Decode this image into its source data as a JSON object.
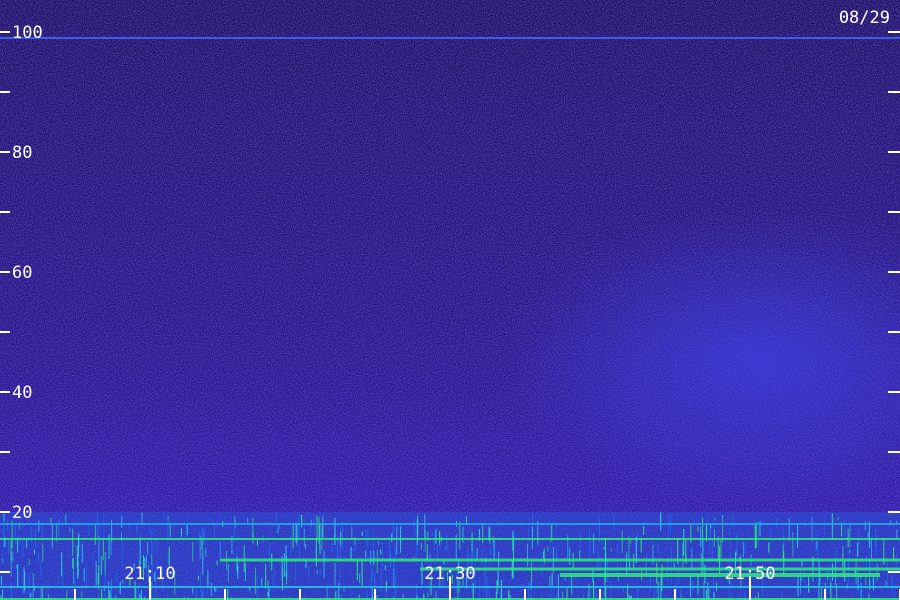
{
  "chart_data": {
    "type": "heatmap",
    "title": "",
    "date": "08/29",
    "xlabel": "",
    "ylabel": "",
    "y_range": [
      0,
      100
    ],
    "y_tick_labels": [
      "100",
      "80",
      "60",
      "40",
      "20"
    ],
    "y_minor_ticks": [
      90,
      70,
      50,
      30,
      10
    ],
    "x_tick_labels": [
      "21:10",
      "21:30",
      "21:50"
    ],
    "x_range_minutes": [
      21,
      81
    ],
    "x_major_ticks_min": [
      26,
      46,
      66
    ],
    "x_minor_ticks_min": [
      31,
      36,
      41,
      51,
      56,
      61,
      71,
      76
    ],
    "colors": {
      "background": "#1a0b4a",
      "noise_high": "#3b22b8",
      "enhanced": "#3343e6",
      "low_band": "#1f6cf0",
      "line_green": "#2cf07a",
      "text": "#ffffff"
    },
    "features": [
      {
        "description_free": true,
        "y_from": 0,
        "y_to": 20,
        "level": "strong",
        "x_from_min": 21,
        "x_to_min": 81
      },
      {
        "y_from": 30,
        "y_to": 55,
        "level": "enhanced",
        "x_from_min": 60,
        "x_to_min": 81
      },
      {
        "y_at": 99,
        "level": "line",
        "x_from_min": 21,
        "x_to_min": 81
      }
    ]
  }
}
